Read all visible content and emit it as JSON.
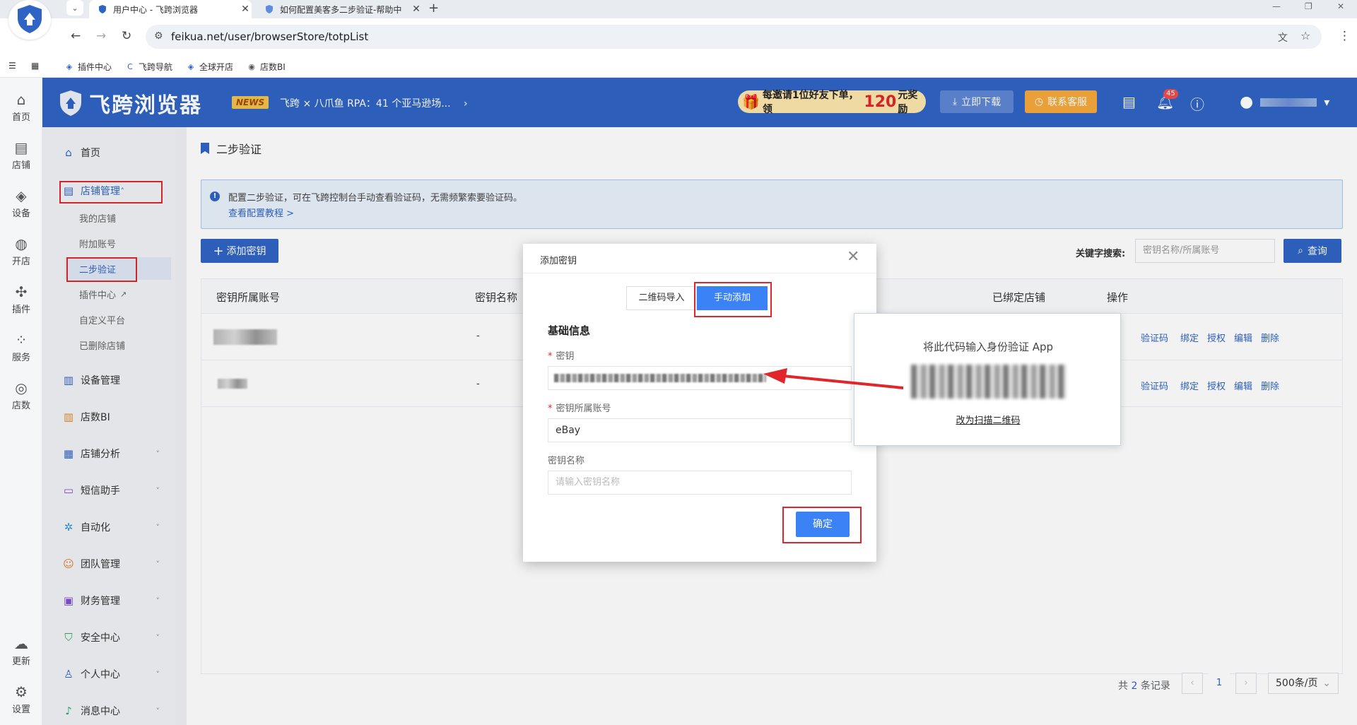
{
  "browser": {
    "tabs": [
      {
        "title": "用户中心 - 飞跨浏览器"
      },
      {
        "title": "如何配置美客多二步验证-帮助中"
      }
    ],
    "url": "feikua.net/user/browserStore/totpList",
    "bookmarks": [
      "插件中心",
      "飞跨导航",
      "全球开店",
      "店数BI"
    ]
  },
  "rail": {
    "items": [
      "首页",
      "店铺",
      "设备",
      "开店",
      "插件",
      "服务",
      "店数"
    ],
    "bottom": [
      "更新",
      "设置"
    ]
  },
  "header": {
    "brand": "飞跨浏览器",
    "news_tag": "NEWS",
    "news_text": "飞跨 × 八爪鱼 RPA：41 个亚马逊场...",
    "invite_pre": "每邀请1位好友下单，领",
    "invite_amount": "120",
    "invite_post": "元奖励",
    "download": "立即下载",
    "service": "联系客服",
    "notify_count": "45"
  },
  "sidebar": {
    "home": "首页",
    "store_mgmt": "店铺管理",
    "sub": [
      "我的店铺",
      "附加账号",
      "二步验证",
      "插件中心",
      "自定义平台",
      "已删除店铺"
    ],
    "items": [
      "设备管理",
      "店数BI",
      "店铺分析",
      "短信助手",
      "自动化",
      "团队管理",
      "财务管理",
      "安全中心",
      "个人中心",
      "消息中心"
    ]
  },
  "page": {
    "breadcrumb": "二步验证",
    "alert_text": "配置二步验证，可在飞跨控制台手动查看验证码，无需频繁索要验证码。",
    "alert_link": "查看配置教程 >",
    "add_button": "添加密钥",
    "keyword_label": "关键字搜索:",
    "keyword_placeholder": "密钥名称/所属账号",
    "query_button": "查询",
    "columns": [
      "密钥所属账号",
      "密钥名称",
      "已绑定店铺",
      "操作"
    ],
    "rows": [
      {
        "name": "-",
        "ops": [
          "验证码",
          "绑定",
          "授权",
          "编辑",
          "删除"
        ]
      },
      {
        "name": "-",
        "ops": [
          "验证码",
          "绑定",
          "授权",
          "编辑",
          "删除"
        ]
      }
    ],
    "total_pre": "共",
    "total_count": "2",
    "total_post": "条记录",
    "page_num": "1",
    "page_size": "500条/页"
  },
  "modal": {
    "title": "添加密钥",
    "tab_qr": "二维码导入",
    "tab_manual": "手动添加",
    "section": "基础信息",
    "label_key": "密钥",
    "label_account": "密钥所属账号",
    "account_value": "eBay",
    "label_name": "密钥名称",
    "name_placeholder": "请输入密钥名称",
    "ok": "确定"
  },
  "popup": {
    "title": "将此代码输入身份验证 App",
    "link": "改为扫描二维码"
  },
  "colors": {
    "primary": "#2f64c4",
    "accent": "#3b82f6",
    "highlight": "#e0262b"
  }
}
